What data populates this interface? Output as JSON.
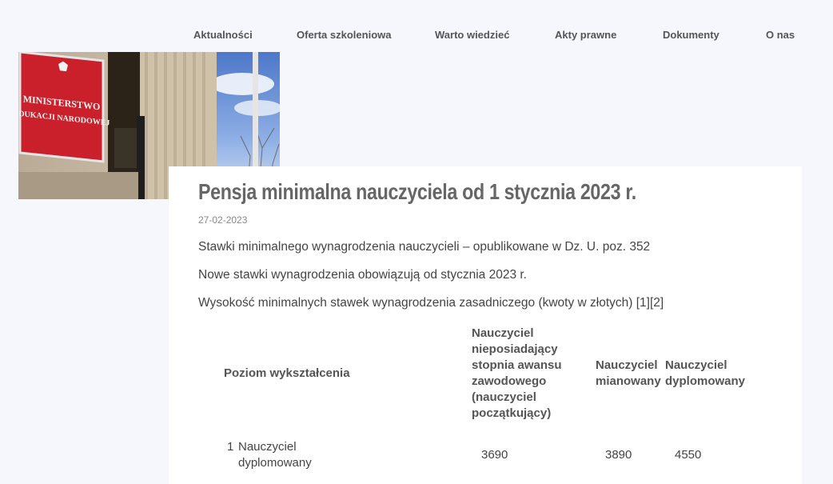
{
  "nav": {
    "items": [
      {
        "label": "Aktualności"
      },
      {
        "label": "Oferta szkoleniowa"
      },
      {
        "label": "Warto wiedzieć"
      },
      {
        "label": "Akty prawne"
      },
      {
        "label": "Dokumenty"
      },
      {
        "label": "O nas"
      }
    ]
  },
  "hero": {
    "sign_line1": "MINISTERSTWO",
    "sign_line2": "EDUKACJI NARODOWEJ"
  },
  "article": {
    "title": "Pensja minimalna nauczyciela od 1 stycznia 2023 r.",
    "date": "27-02-2023",
    "paragraphs": [
      "Stawki minimalnego wynagrodzenia nauczycieli – opublikowane w Dz. U. poz. 352",
      "Nowe stawki wynagrodzenia obowiązują od stycznia 2023 r.",
      "Wysokość minimalnych stawek wynagrodzenia zasadniczego (kwoty w złotych) [1][2]"
    ]
  },
  "table": {
    "headers": {
      "level": "Poziom wykształcenia",
      "beginner": "Nauczyciel nieposiadający stopnia awansu zawodowego (nauczyciel początkujący)",
      "appointed": "Nauczyciel mianowany",
      "certified": "Nauczyciel dyplomowany"
    },
    "rows": [
      {
        "num": "1",
        "level": "Nauczyciel dyplomowany",
        "beginner": "3690",
        "appointed": "3890",
        "certified": "4550"
      }
    ]
  }
}
